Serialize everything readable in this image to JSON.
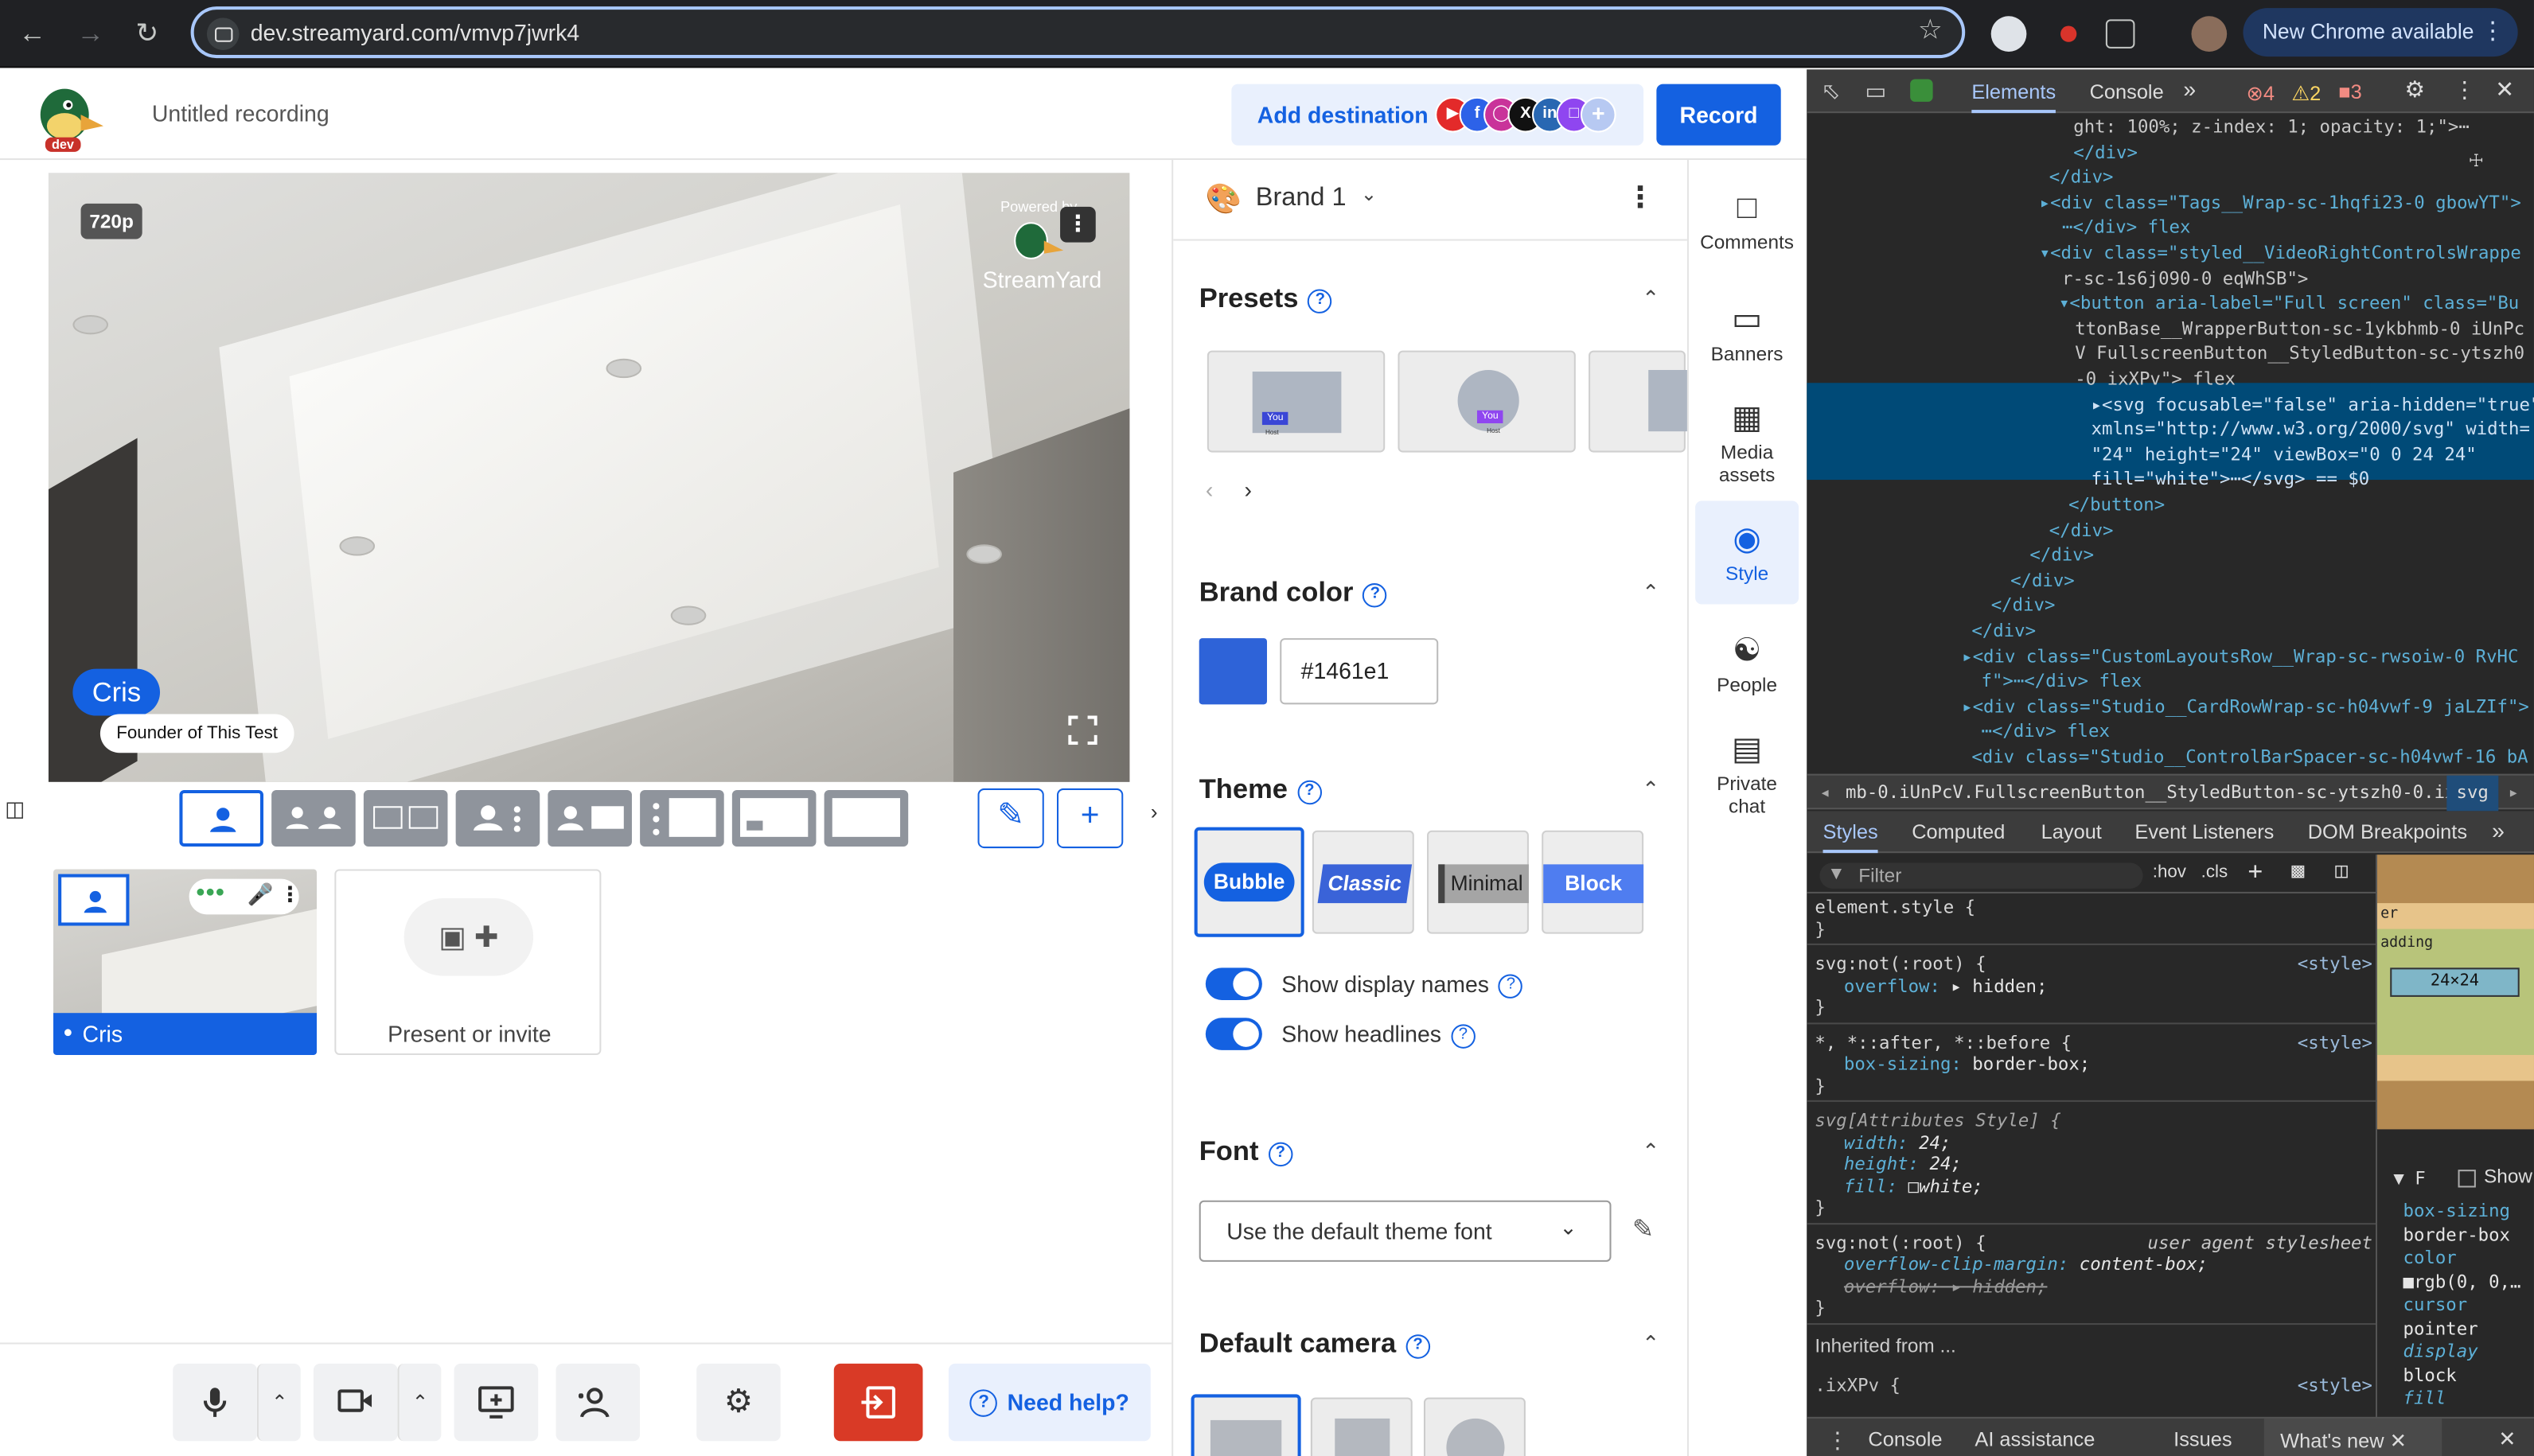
{
  "browser": {
    "url": "dev.streamyard.com/vmvp7jwrk4",
    "new_chrome": "New Chrome available"
  },
  "header": {
    "logo_badge": "dev",
    "title": "Untitled recording",
    "add_destination": "Add destination",
    "destinations": [
      "youtube",
      "facebook",
      "instagram",
      "x",
      "linkedin",
      "twitch",
      "more"
    ],
    "record": "Record"
  },
  "stage": {
    "resolution": "720p",
    "powered_by": "Powered by",
    "brand_name": "StreamYard",
    "name": "Cris",
    "headline": "Founder of This Test"
  },
  "participants": {
    "self_name": "Cris",
    "present_invite": "Present or invite"
  },
  "bottombar": {
    "need_help": "Need help?"
  },
  "panel": {
    "brand": "Brand 1",
    "presets_title": "Presets",
    "preset_you": "You",
    "preset_host": "Host",
    "brand_color_title": "Brand color",
    "brand_color_value": "#1461e1",
    "theme_title": "Theme",
    "themes": [
      "Bubble",
      "Classic",
      "Minimal",
      "Block"
    ],
    "show_display_names": "Show display names",
    "show_headlines": "Show headlines",
    "font_title": "Font",
    "font_value": "Use the default theme font",
    "default_camera_title": "Default camera"
  },
  "rail": {
    "comments": "Comments",
    "banners": "Banners",
    "media_assets": "Media assets",
    "style": "Style",
    "people": "People",
    "private_chat": "Private chat"
  },
  "devtools": {
    "tabs": [
      "Elements",
      "Console"
    ],
    "errors": "4",
    "warnings": "2",
    "issues": "3",
    "dom_lines": [
      "ght: 100%; z-index: 1; opacity: 1;\">⋯",
      "</div>",
      "</div>",
      "▸<div class=\"Tags__Wrap-sc-1hqfi23-0 gbowYT\">",
      "⋯</div> flex",
      "▾<div class=\"styled__VideoRightControlsWrappe",
      "r-sc-1s6j090-0 eqWhSB\">",
      "▾<button aria-label=\"Full screen\" class=\"Bu",
      "ttonBase__WrapperButton-sc-1ykbhmb-0 iUnPc",
      "V FullscreenButton__StyledButton-sc-ytszh0",
      "-0 ixXPv\"> flex",
      "▸<svg focusable=\"false\" aria-hidden=\"true\"",
      "xmlns=\"http://www.w3.org/2000/svg\" width=",
      "\"24\" height=\"24\" viewBox=\"0 0 24 24\"",
      "fill=\"white\">⋯</svg> == $0",
      "</button>",
      "</div>",
      "</div>",
      "</div>",
      "</div>",
      "</div>",
      "▸<div class=\"CustomLayoutsRow__Wrap-sc-rwsoiw-0 RvHC",
      "f\">⋯</div> flex",
      "▸<div class=\"Studio__CardRowWrap-sc-h04vwf-9 jaLZIf\">",
      "⋯</div> flex",
      "<div class=\"Studio__ControlBarSpacer-sc-h04vwf-16 bA",
      "RwIc\"></div>"
    ],
    "breadcrumb": "mb-0.iUnPcV.FullscreenButton__StyledButton-sc-ytszh0-0.ixXPv",
    "breadcrumb_tail": "svg",
    "style_tabs": [
      "Styles",
      "Computed",
      "Layout",
      "Event Listeners",
      "DOM Breakpoints"
    ],
    "filter": "Filter",
    "hov": ":hov",
    "cls": ".cls",
    "rules": [
      {
        "sel": "element.style {",
        "lines": [
          "}"
        ],
        "src": ""
      },
      {
        "sel": "svg:not(:root) {",
        "lines": [
          "overflow: ▸ hidden;",
          "}"
        ],
        "src": "<style>"
      },
      {
        "sel": "*, *::after, *::before {",
        "lines": [
          "box-sizing: border-box;",
          "}"
        ],
        "src": "<style>"
      },
      {
        "sel": "svg[Attributes Style] {",
        "lines": [
          "width: 24;",
          "height: 24;",
          "fill: □white;",
          "}"
        ],
        "src": ""
      },
      {
        "sel": "svg:not(:root) {",
        "lines": [
          "overflow-clip-margin: content-box;",
          "overflow: ▸ hidden;",
          "}"
        ],
        "src": "user agent stylesheet"
      }
    ],
    "inherited": "Inherited from ...",
    "last_sel": ".ixXPv {",
    "last_src": "<style>",
    "box_size": "24×24",
    "box_margin": "er",
    "box_padding": "adding",
    "show_label": "Show",
    "computed": [
      "box-sizing",
      "border-box",
      "color",
      "■rgb(0, 0,…",
      "cursor",
      "pointer",
      "display",
      "block",
      "fill"
    ],
    "bottom_tabs": [
      "Console",
      "AI assistance",
      "Issues",
      "What's new"
    ]
  }
}
